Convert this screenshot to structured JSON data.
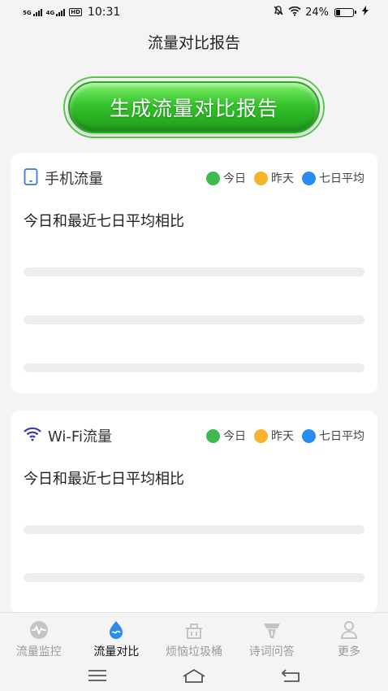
{
  "status": {
    "net1": "5G",
    "net2": "4G",
    "hd": "HD",
    "time": "10:31",
    "battery_text": "24%",
    "battery_level": 0.24
  },
  "header": {
    "title": "流量对比报告"
  },
  "generate_button": {
    "label": "生成流量对比报告"
  },
  "legend": [
    {
      "label": "今日",
      "color": "#3dbb4f"
    },
    {
      "label": "昨天",
      "color": "#f7b32b"
    },
    {
      "label": "七日平均",
      "color": "#2b8cf0"
    }
  ],
  "cards": [
    {
      "title": "手机流量",
      "icon": "phone-icon",
      "subtitle": "今日和最近七日平均相比"
    },
    {
      "title": "Wi-Fi流量",
      "icon": "wifi-icon",
      "subtitle": "今日和最近七日平均相比"
    }
  ],
  "nav": [
    {
      "label": "流量监控",
      "icon": "monitor-icon",
      "active": false
    },
    {
      "label": "流量对比",
      "icon": "compare-icon",
      "active": true
    },
    {
      "label": "烦恼垃圾桶",
      "icon": "trash-icon",
      "active": false
    },
    {
      "label": "诗词问答",
      "icon": "poem-icon",
      "active": false
    },
    {
      "label": "更多",
      "icon": "user-icon",
      "active": false
    }
  ],
  "colors": {
    "accent_green": "#35c22d",
    "active_blue": "#2b8cf0",
    "phone_icon": "#3a78d8",
    "wifi_icon": "#3b3bb0"
  }
}
